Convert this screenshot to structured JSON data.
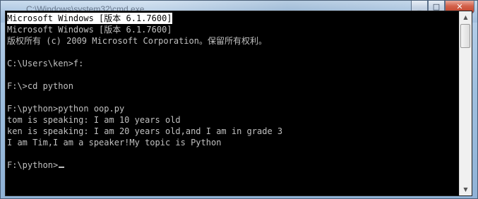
{
  "window": {
    "title_partial": "C:\\Windows\\system32\\cmd.exe"
  },
  "controls": {
    "minimize_glyph": "_",
    "maximize_glyph": "□",
    "close_glyph": "✕"
  },
  "console": {
    "header_line": "Microsoft Windows [版本 6.1.7600]",
    "lines": [
      "Microsoft Windows [版本 6.1.7600]",
      "版权所有 (c) 2009 Microsoft Corporation。保留所有权利。",
      "",
      "C:\\Users\\ken>f:",
      "",
      "F:\\>cd python",
      "",
      "F:\\python>python oop.py",
      "tom is speaking: I am 10 years old",
      "ken is speaking: I am 20 years old,and I am in grade 3",
      "I am Tim,I am a speaker!My topic is Python",
      "",
      "F:\\python>"
    ]
  },
  "scrollbar": {
    "up_glyph": "▲",
    "down_glyph": "▼"
  }
}
